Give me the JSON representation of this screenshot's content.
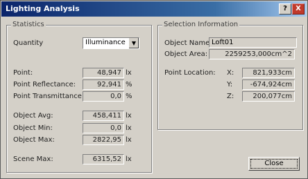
{
  "window": {
    "title": "Lighting Analysis",
    "help_label": "?",
    "close_label": "X"
  },
  "statistics": {
    "group_label": "Statistics",
    "quantity_label": "Quantity",
    "quantity_selected": "Illuminance",
    "rows": [
      {
        "label": "Point:",
        "value": "48,947",
        "unit": "lx"
      },
      {
        "label": "Point Reflectance:",
        "value": "92,941",
        "unit": "%"
      },
      {
        "label": "Point Transmittance:",
        "value": "0,0",
        "unit": "%"
      },
      {
        "label": "Object Avg:",
        "value": "458,411",
        "unit": "lx"
      },
      {
        "label": "Object Min:",
        "value": "0,0",
        "unit": "lx"
      },
      {
        "label": "Object Max:",
        "value": "2822,95",
        "unit": "lx"
      },
      {
        "label": "Scene Max:",
        "value": "6315,52",
        "unit": "lx"
      }
    ]
  },
  "selection": {
    "group_label": "Selection Information",
    "object_name_label": "Object Name:",
    "object_name_value": "Loft01",
    "object_area_label": "Object Area:",
    "object_area_value": "2259253,000cm^2",
    "point_location_label": "Point Location:",
    "x_label": "X:",
    "x_value": "821,933cm",
    "y_label": "Y:",
    "y_value": "-674,924cm",
    "z_label": "Z:",
    "z_value": "200,077cm"
  },
  "buttons": {
    "close_label": "Close"
  }
}
